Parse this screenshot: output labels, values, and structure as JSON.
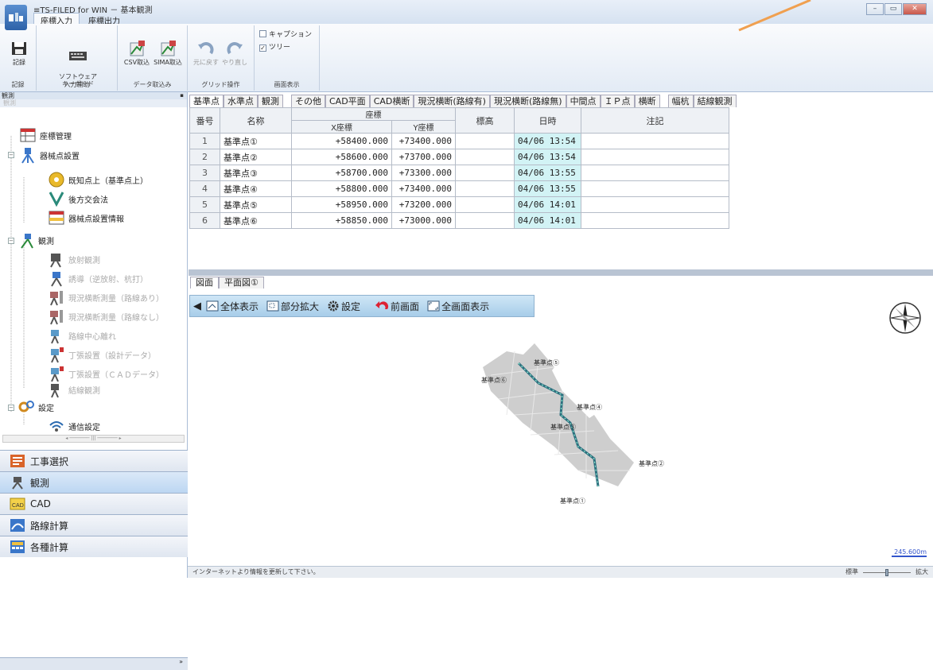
{
  "app": {
    "title": "≡TS-FILED for WIN － 基本観測",
    "icon": "app-logo"
  },
  "ribbon": {
    "tabs": [
      "座標入力",
      "座標出力"
    ],
    "groups": [
      {
        "label": "記録",
        "buttons": [
          "記録"
        ]
      },
      {
        "label": "入力補助",
        "buttons": [
          "ソフトウェア\nキーボード"
        ]
      },
      {
        "label": "データ取込み",
        "buttons": [
          "CSV取込",
          "SIMA取込"
        ]
      },
      {
        "label": "グリッド操作",
        "buttons": [
          "元に戻す",
          "やり直し"
        ]
      },
      {
        "label": "画面表示",
        "checks": [
          {
            "label": "キャプション",
            "checked": false
          },
          {
            "label": "ツリー",
            "checked": true
          }
        ]
      }
    ]
  },
  "leftpanel": {
    "header": "観測",
    "sub": "観測",
    "tree": [
      {
        "label": "座標管理",
        "disabled": false
      },
      {
        "label": "器械点設置",
        "disabled": false
      },
      {
        "label": "既知点上（基準点上）",
        "disabled": false
      },
      {
        "label": "後方交会法",
        "disabled": false
      },
      {
        "label": "器械点設置情報",
        "disabled": false
      },
      {
        "label": "観測",
        "disabled": false
      },
      {
        "label": "放射観測",
        "disabled": true
      },
      {
        "label": "誘導（逆放射、杭打）",
        "disabled": true
      },
      {
        "label": "現況横断測量（路線あり）",
        "disabled": true
      },
      {
        "label": "現況横断測量（路線なし）",
        "disabled": true
      },
      {
        "label": "路線中心離れ",
        "disabled": true
      },
      {
        "label": "丁張設置（設計データ）",
        "disabled": true
      },
      {
        "label": "丁張設置（ＣＡＤデータ）",
        "disabled": true
      },
      {
        "label": "結線観測",
        "disabled": true
      },
      {
        "label": "設定",
        "disabled": false
      },
      {
        "label": "通信設定",
        "disabled": false
      }
    ],
    "nav": [
      {
        "label": "工事選択",
        "active": false
      },
      {
        "label": "観測",
        "active": true
      },
      {
        "label": "CAD",
        "active": false
      },
      {
        "label": "路線計算",
        "active": false
      },
      {
        "label": "各種計算",
        "active": false
      }
    ]
  },
  "grid": {
    "tabs": [
      "基準点",
      "水準点",
      "観測",
      "その他",
      "CAD平面",
      "CAD横断",
      "現況横断(路線有)",
      "現況横断(路線無)",
      "中間点",
      "ＩＰ点",
      "横断",
      "幅杭",
      "結線観測"
    ],
    "headers": {
      "no": "番号",
      "name": "名称",
      "coord": "座標",
      "x": "X座標",
      "y": "Y座標",
      "elev": "標高",
      "date": "日時",
      "note": "注記"
    },
    "rows": [
      {
        "no": "1",
        "name": "基準点①",
        "x": "+58400.000",
        "y": "+73400.000",
        "elev": "",
        "date": "04/06 13:54",
        "note": ""
      },
      {
        "no": "2",
        "name": "基準点②",
        "x": "+58600.000",
        "y": "+73700.000",
        "elev": "",
        "date": "04/06 13:54",
        "note": ""
      },
      {
        "no": "3",
        "name": "基準点③",
        "x": "+58700.000",
        "y": "+73300.000",
        "elev": "",
        "date": "04/06 13:55",
        "note": ""
      },
      {
        "no": "4",
        "name": "基準点④",
        "x": "+58800.000",
        "y": "+73400.000",
        "elev": "",
        "date": "04/06 13:55",
        "note": ""
      },
      {
        "no": "5",
        "name": "基準点⑤",
        "x": "+58950.000",
        "y": "+73200.000",
        "elev": "",
        "date": "04/06 14:01",
        "note": ""
      },
      {
        "no": "6",
        "name": "基準点⑥",
        "x": "+58850.000",
        "y": "+73000.000",
        "elev": "",
        "date": "04/06 14:01",
        "note": ""
      }
    ]
  },
  "drawing": {
    "tabs": [
      "図面",
      "平面図①"
    ],
    "toolbar": [
      "全体表示",
      "部分拡大",
      "設定",
      "前画面",
      "全画面表示"
    ],
    "points": [
      "基準点⑤",
      "基準点⑥",
      "基準点④",
      "基準点③",
      "基準点②",
      "基準点①"
    ]
  },
  "status": {
    "message": "インターネットより情報を更新して下さい。",
    "zoom_left": "標準",
    "zoom_right": "拡大",
    "scale": "245.600m",
    "corner": "»"
  },
  "colors": {
    "date_cell": "#d2f3f5",
    "toolbar": "#bcdcf0",
    "route": "#2d6e7e",
    "annotation_arrow": "#f0a050"
  }
}
